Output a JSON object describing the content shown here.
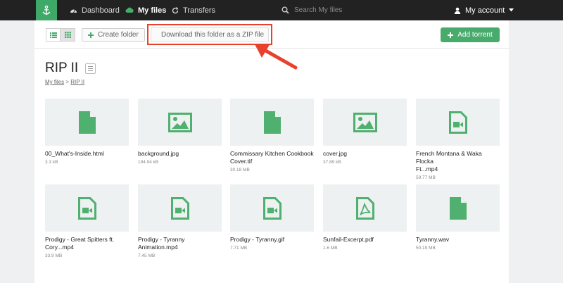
{
  "nav": {
    "dashboard": "Dashboard",
    "my_files": "My files",
    "transfers": "Transfers",
    "search_placeholder": "Search My files",
    "account": "My account"
  },
  "toolbar": {
    "create_folder": "Create folder",
    "download_zip": "Download this folder as a ZIP file",
    "add_torrent": "Add torrent"
  },
  "folder": {
    "title": "RIP II",
    "breadcrumb": [
      "My files",
      "RIP II"
    ],
    "breadcrumb_sep": ">"
  },
  "files": [
    {
      "name": "00_What's-Inside.html",
      "size": "3.3 kB",
      "icon": "document-icon"
    },
    {
      "name": "background.jpg",
      "size": "194.94 kB",
      "icon": "image-icon"
    },
    {
      "name": "Commissary Kitchen Cookbook\nCover.tif",
      "size": "30.18 MB",
      "icon": "document-icon"
    },
    {
      "name": "cover.jpg",
      "size": "37.89 kB",
      "icon": "image-icon"
    },
    {
      "name": "French Montana & Waka Flocka\nFt...mp4",
      "size": "59.77 MB",
      "icon": "video-icon"
    },
    {
      "name": "Prodigy - Great Spitters ft.\nCory...mp4",
      "size": "33.9 MB",
      "icon": "video-icon"
    },
    {
      "name": "Prodigy - Tyranny\nAnimation.mp4",
      "size": "7.45 MB",
      "icon": "video-icon"
    },
    {
      "name": "Prodigy - Tyranny.gif",
      "size": "7.71 MB",
      "icon": "video-icon"
    },
    {
      "name": "Sunfail-Excerpt.pdf",
      "size": "1.6 MB",
      "icon": "pdf-icon"
    },
    {
      "name": "Tyranny.wav",
      "size": "50.19 MB",
      "icon": "document-icon"
    }
  ],
  "colors": {
    "accent": "#48ab6b",
    "nav_bg": "#222222",
    "highlight": "#e8412c"
  }
}
